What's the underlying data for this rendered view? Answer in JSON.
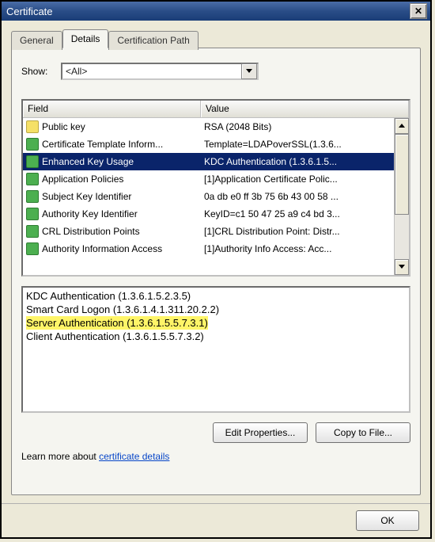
{
  "window": {
    "title": "Certificate"
  },
  "tabs": {
    "general": "General",
    "details": "Details",
    "certpath": "Certification Path"
  },
  "show": {
    "label": "Show:",
    "value": "<All>"
  },
  "columns": {
    "field": "Field",
    "value": "Value"
  },
  "rows": [
    {
      "icon": "yellow",
      "field": "Public key",
      "value": "RSA (2048 Bits)",
      "selected": false
    },
    {
      "icon": "green",
      "field": "Certificate Template Inform...",
      "value": "Template=LDAPoverSSL(1.3.6...",
      "selected": false
    },
    {
      "icon": "green",
      "field": "Enhanced Key Usage",
      "value": "KDC Authentication (1.3.6.1.5...",
      "selected": true
    },
    {
      "icon": "green",
      "field": "Application Policies",
      "value": "[1]Application Certificate Polic...",
      "selected": false
    },
    {
      "icon": "green",
      "field": "Subject Key Identifier",
      "value": "0a db e0 ff 3b 75 6b 43 00 58 ...",
      "selected": false
    },
    {
      "icon": "green",
      "field": "Authority Key Identifier",
      "value": "KeyID=c1 50 47 25 a9 c4 bd 3...",
      "selected": false
    },
    {
      "icon": "green",
      "field": "CRL Distribution Points",
      "value": "[1]CRL Distribution Point: Distr...",
      "selected": false
    },
    {
      "icon": "green",
      "field": "Authority Information Access",
      "value": "[1]Authority Info Access: Acc...",
      "selected": false
    }
  ],
  "detail": {
    "lines": [
      {
        "text": "KDC Authentication (1.3.6.1.5.2.3.5)",
        "highlight": false
      },
      {
        "text": "Smart Card Logon (1.3.6.1.4.1.311.20.2.2)",
        "highlight": false
      },
      {
        "text": "Server Authentication (1.3.6.1.5.5.7.3.1)",
        "highlight": true
      },
      {
        "text": "Client Authentication (1.3.6.1.5.5.7.3.2)",
        "highlight": false
      }
    ]
  },
  "buttons": {
    "edit": "Edit Properties...",
    "copy": "Copy to File...",
    "ok": "OK"
  },
  "learn": {
    "prefix": "Learn more about ",
    "link": "certificate details"
  }
}
